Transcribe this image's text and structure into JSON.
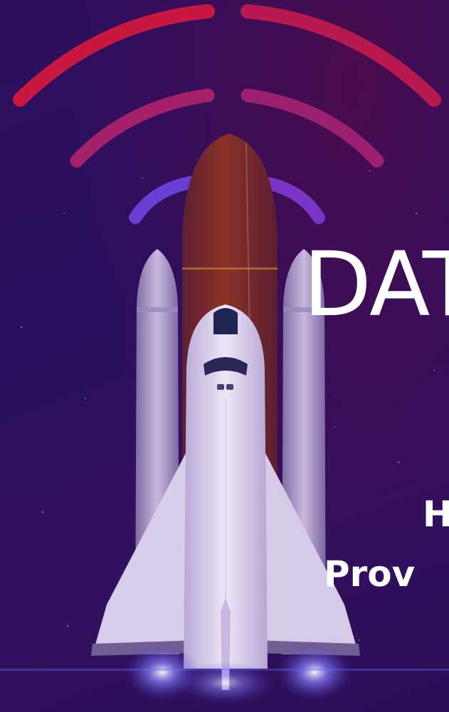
{
  "banner": {
    "headline": "DAT",
    "subtitle_line_1": "H",
    "subtitle_line_2": "Prov"
  },
  "colors": {
    "background": "#2a0f56",
    "signal_outer": "#c8183f",
    "signal_middle": "#a42068",
    "signal_inner": "#6a3fd6",
    "external_tank": "#8a3226",
    "shuttle_body": "#ddd2ec",
    "engine_glow": "#8f86ff",
    "text": "#ffffff"
  },
  "icons": [
    "signal-waves-icon",
    "space-shuttle-illustration"
  ]
}
